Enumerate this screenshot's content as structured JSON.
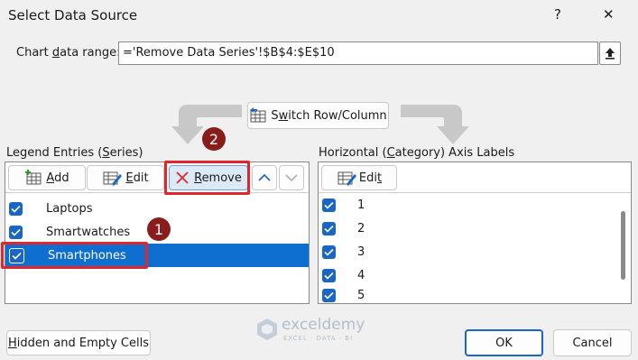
{
  "dialog": {
    "title": "Select Data Source",
    "help": "?",
    "close": "✕"
  },
  "range": {
    "label_pre": "Chart ",
    "label_ul": "d",
    "label_post": "ata range:",
    "value": "='Remove Data Series'!$B$4:$E$10"
  },
  "switch": {
    "label_pre": "S",
    "label_ul": "w",
    "label_post": "itch Row/Column"
  },
  "legend": {
    "title_pre": "Legend Entries (",
    "title_ul": "S",
    "title_post": "eries)",
    "add_ul": "A",
    "add_post": "dd",
    "edit_pre": "",
    "edit_ul": "E",
    "edit_post": "dit",
    "remove_ul": "R",
    "remove_post": "emove",
    "up": "▲",
    "down": "▼",
    "items": [
      {
        "label": "Laptops",
        "checked": true,
        "selected": false
      },
      {
        "label": "Smartwatches",
        "checked": true,
        "selected": false
      },
      {
        "label": "Smartphones",
        "checked": true,
        "selected": true
      }
    ]
  },
  "axis": {
    "title_pre": "Horizontal (",
    "title_ul": "C",
    "title_post": "ategory) Axis Labels",
    "edit_pre": "Edi",
    "edit_ul": "t",
    "edit_post": "",
    "items": [
      "1",
      "2",
      "3",
      "4",
      "5"
    ]
  },
  "footer": {
    "hidden_pre": "",
    "hidden_ul": "H",
    "hidden_post": "idden and Empty Cells",
    "ok": "OK",
    "cancel": "Cancel"
  },
  "callouts": [
    "1",
    "2"
  ],
  "watermark": {
    "name": "exceldemy",
    "tagline": "EXCEL · DATA · BI"
  },
  "colors": {
    "accent": "#1a66c4",
    "selection": "#0f6fd0",
    "highlight": "#e3262b",
    "callout": "#8b1c1c"
  }
}
